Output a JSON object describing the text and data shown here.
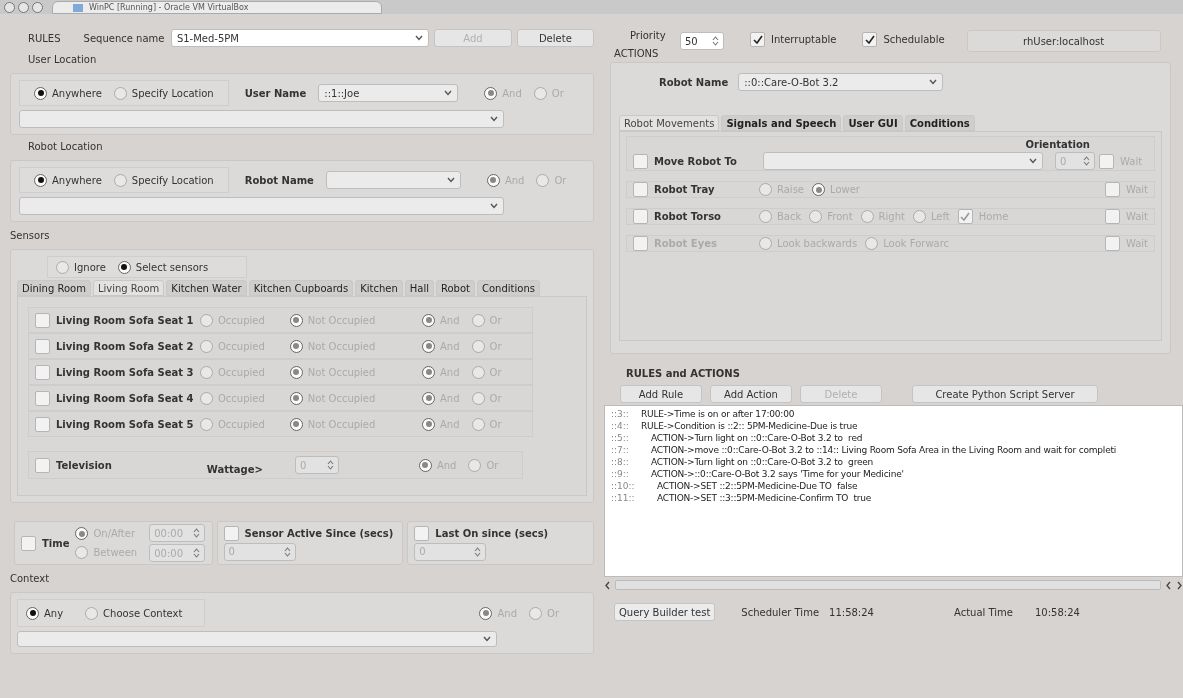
{
  "title_bar": {
    "title": "WinPC [Running] - Oracle VM VirtualBox"
  },
  "rules": {
    "label": "RULES",
    "sequence_label": "Sequence name",
    "sequence_value": "S1-Med-5PM",
    "buttons": [
      {
        "label": "Add",
        "disabled": true
      },
      {
        "label": "Delete",
        "disabled": false
      }
    ]
  },
  "header": {
    "priority_label": "Priority",
    "priority_value": "50",
    "checks": [
      {
        "label": "Interruptable",
        "checked": true
      },
      {
        "label": "Schedulable",
        "checked": true
      }
    ],
    "host": "rhUser:localhost"
  },
  "user_location": {
    "title": "User Location",
    "options": {
      "disabled": false,
      "items": [
        {
          "label": "Anywhere",
          "selected": true
        },
        {
          "label": "Specify Location",
          "selected": false
        }
      ]
    },
    "name_label": "User Name",
    "name_value": "::1::Joe",
    "logic": {
      "disabled": true,
      "items": [
        {
          "label": "And",
          "selected": true
        },
        {
          "label": "Or",
          "selected": false
        }
      ]
    }
  },
  "robot_location": {
    "title": "Robot Location",
    "options": {
      "disabled": false,
      "items": [
        {
          "label": "Anywhere",
          "selected": true
        },
        {
          "label": "Specify Location",
          "selected": false
        }
      ]
    },
    "name_label": "Robot Name",
    "logic": {
      "disabled": true,
      "items": [
        {
          "label": "And",
          "selected": true
        },
        {
          "label": "Or",
          "selected": false
        }
      ]
    }
  },
  "sensors": {
    "title": "Sensors",
    "mode": {
      "disabled": false,
      "items": [
        {
          "label": "Ignore",
          "selected": false
        },
        {
          "label": "Select sensors",
          "selected": true
        }
      ]
    },
    "tabs": [
      {
        "label": "Dining Room",
        "selected": false
      },
      {
        "label": "Living Room",
        "selected": true
      },
      {
        "label": "Kitchen Water",
        "selected": false
      },
      {
        "label": "Kitchen Cupboards",
        "selected": false
      },
      {
        "label": "Kitchen",
        "selected": false
      },
      {
        "label": "Hall",
        "selected": false
      },
      {
        "label": "Robot",
        "selected": false
      },
      {
        "label": "Conditions",
        "selected": false
      }
    ],
    "rows": [
      {
        "label": "Living Room Sofa Seat 1",
        "checked": false,
        "states": {
          "disabled": true,
          "items": [
            {
              "label": "Occupied",
              "selected": false
            },
            {
              "label": "Not Occupied",
              "selected": true
            }
          ]
        },
        "logic": {
          "disabled": true,
          "items": [
            {
              "label": "And",
              "selected": true
            },
            {
              "label": "Or",
              "selected": false
            }
          ]
        }
      },
      {
        "label": "Living Room Sofa Seat 2",
        "checked": false,
        "states": {
          "disabled": true,
          "items": [
            {
              "label": "Occupied",
              "selected": false
            },
            {
              "label": "Not Occupied",
              "selected": true
            }
          ]
        },
        "logic": {
          "disabled": true,
          "items": [
            {
              "label": "And",
              "selected": true
            },
            {
              "label": "Or",
              "selected": false
            }
          ]
        }
      },
      {
        "label": "Living Room Sofa Seat 3",
        "checked": false,
        "states": {
          "disabled": true,
          "items": [
            {
              "label": "Occupied",
              "selected": false
            },
            {
              "label": "Not Occupied",
              "selected": true
            }
          ]
        },
        "logic": {
          "disabled": true,
          "items": [
            {
              "label": "And",
              "selected": true
            },
            {
              "label": "Or",
              "selected": false
            }
          ]
        }
      },
      {
        "label": "Living Room Sofa Seat 4",
        "checked": false,
        "states": {
          "disabled": true,
          "items": [
            {
              "label": "Occupied",
              "selected": false
            },
            {
              "label": "Not Occupied",
              "selected": true
            }
          ]
        },
        "logic": {
          "disabled": true,
          "items": [
            {
              "label": "And",
              "selected": true
            },
            {
              "label": "Or",
              "selected": false
            }
          ]
        }
      },
      {
        "label": "Living Room Sofa Seat 5",
        "checked": false,
        "states": {
          "disabled": true,
          "items": [
            {
              "label": "Occupied",
              "selected": false
            },
            {
              "label": "Not Occupied",
              "selected": true
            }
          ]
        },
        "logic": {
          "disabled": true,
          "items": [
            {
              "label": "And",
              "selected": true
            },
            {
              "label": "Or",
              "selected": false
            }
          ]
        }
      }
    ],
    "television": {
      "label": "Television",
      "checked": false,
      "wattage_label": "Wattage>",
      "wattage_value": "0",
      "logic": {
        "disabled": true,
        "items": [
          {
            "label": "And",
            "selected": true
          },
          {
            "label": "Or",
            "selected": false
          }
        ]
      }
    }
  },
  "time": {
    "label": "Time",
    "checked": false,
    "modes": {
      "disabled": true,
      "items": [
        {
          "label": "On/After",
          "selected": true
        },
        {
          "label": "Between",
          "selected": false
        }
      ]
    },
    "times": [
      "00:00",
      "00:00"
    ]
  },
  "since": [
    {
      "label": "Sensor Active Since (secs)",
      "checked": false,
      "value": "0"
    },
    {
      "label": "Last On since (secs)",
      "checked": false,
      "value": "0"
    }
  ],
  "context": {
    "title": "Context",
    "options": {
      "disabled": false,
      "items": [
        {
          "label": "Any",
          "selected": true
        },
        {
          "label": "Choose Context",
          "selected": false
        }
      ]
    },
    "logic": {
      "disabled": true,
      "items": [
        {
          "label": "And",
          "selected": true
        },
        {
          "label": "Or",
          "selected": false
        }
      ]
    }
  },
  "actions": {
    "title": "ACTIONS",
    "robot_label": "Robot Name",
    "robot_value": "::0::Care-O-Bot 3.2",
    "tabs": [
      {
        "label": "Robot Movements",
        "selected": true
      },
      {
        "label": "Signals and Speech",
        "selected": false
      },
      {
        "label": "User GUI",
        "selected": false
      },
      {
        "label": "Conditions",
        "selected": false
      }
    ],
    "orientation_label": "Orientation",
    "rows": [
      {
        "kind": "move",
        "label": "Move Robot To",
        "checked": false,
        "disabled": false,
        "orientation_value": "0",
        "wait": {
          "label": "Wait",
          "checked": false
        }
      },
      {
        "kind": "options",
        "label": "Robot Tray",
        "checked": false,
        "disabled": false,
        "options": [
          {
            "kind": "radio",
            "label": "Raise",
            "selected": false
          },
          {
            "kind": "radio",
            "label": "Lower",
            "selected": true
          }
        ],
        "wait": {
          "label": "Wait",
          "checked": false
        }
      },
      {
        "kind": "options",
        "label": "Robot Torso",
        "checked": false,
        "disabled": false,
        "options": [
          {
            "kind": "radio",
            "label": "Back",
            "selected": false
          },
          {
            "kind": "radio",
            "label": "Front",
            "selected": false
          },
          {
            "kind": "radio",
            "label": "Right",
            "selected": false
          },
          {
            "kind": "radio",
            "label": "Left",
            "selected": false
          },
          {
            "kind": "check",
            "label": "Home",
            "checked": true
          }
        ],
        "wait": {
          "label": "Wait",
          "checked": false
        }
      },
      {
        "kind": "options",
        "label": "Robot Eyes",
        "checked": false,
        "disabled": true,
        "options": [
          {
            "kind": "radio",
            "label": "Look backwards",
            "selected": false
          },
          {
            "kind": "radio",
            "label": "Look Forwarc",
            "selected": false
          }
        ],
        "wait": {
          "label": "Wait",
          "checked": false
        }
      }
    ]
  },
  "rules_and_actions": {
    "title": "RULES and ACTIONS",
    "buttons": [
      {
        "label": "Add Rule",
        "disabled": false
      },
      {
        "label": "Add Action",
        "disabled": false
      },
      {
        "label": "Delete",
        "disabled": true
      },
      {
        "label": "Create Python Script Server",
        "disabled": false
      }
    ],
    "lines": [
      {
        "kind": "rule",
        "index": "::3::",
        "text": "RULE->Time is on or after 17:00:00"
      },
      {
        "kind": "rule",
        "index": "::4::",
        "text": "RULE->Condition is ::2:: 5PM-Medicine-Due is true"
      },
      {
        "kind": "action",
        "index": "::5::",
        "text": "ACTION->Turn light on ::0::Care-O-Bot 3.2 to  red"
      },
      {
        "kind": "action",
        "index": "::7::",
        "text": "ACTION->move ::0::Care-O-Bot 3.2 to ::14:: Living Room Sofa Area in the Living Room and wait for completi"
      },
      {
        "kind": "action",
        "index": "::8::",
        "text": "ACTION->Turn light on ::0::Care-O-Bot 3.2 to  green"
      },
      {
        "kind": "action",
        "index": "::9::",
        "text": "ACTION->::0::Care-O-Bot 3.2 says 'Time for your Medicine'"
      },
      {
        "kind": "set",
        "index": "::10::",
        "text": "ACTION->SET ::2::5PM-Medicine-Due TO  false"
      },
      {
        "kind": "set",
        "index": "::11::",
        "text": "ACTION->SET ::3::5PM-Medicine-Confirm TO  true"
      }
    ]
  },
  "status": {
    "query_button": "Query Builder test",
    "scheduler_label": "Scheduler Time",
    "scheduler_value": "11:58:24",
    "actual_label": "Actual Time",
    "actual_value": "10:58:24"
  }
}
